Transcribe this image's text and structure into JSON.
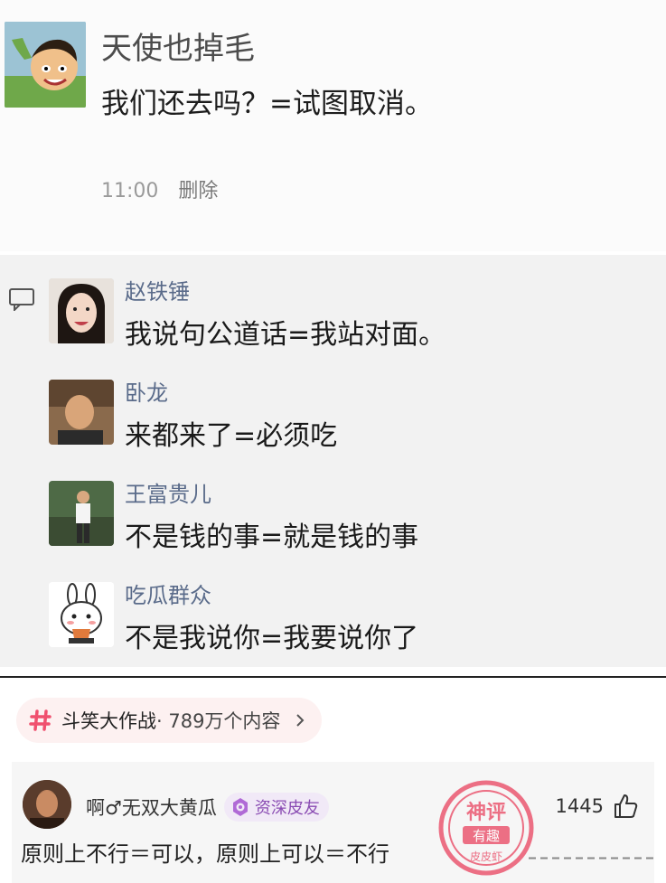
{
  "post": {
    "name": "天使也掉毛",
    "text": "我们还去吗？=试图取消。",
    "time": "11:00",
    "delete_label": "删除"
  },
  "comments": [
    {
      "name": "赵铁锤",
      "text": "我说句公道话=我站对面。"
    },
    {
      "name": "卧龙",
      "text": "来都来了=必须吃"
    },
    {
      "name": "王富贵儿",
      "text": "不是钱的事=就是钱的事"
    },
    {
      "name": "吃瓜群众",
      "text": "不是我说你=我要说你了"
    }
  ],
  "topic": {
    "name": "斗笑大作战",
    "count": "· 789万个内容"
  },
  "hot_comment": {
    "user": "啊♂无双大黄瓜",
    "badge": "资深皮友",
    "likes": "1445",
    "text": "原则上不行＝可以，原则上可以＝不行"
  },
  "stamp": {
    "line1": "神评",
    "line2": "有趣",
    "line3": "皮皮虾"
  },
  "colors": {
    "comment_name": "#5a6b8a",
    "topic_hash": "#f0506e",
    "badge_purple": "#8a4cb3",
    "stamp_red": "#e9435f"
  }
}
